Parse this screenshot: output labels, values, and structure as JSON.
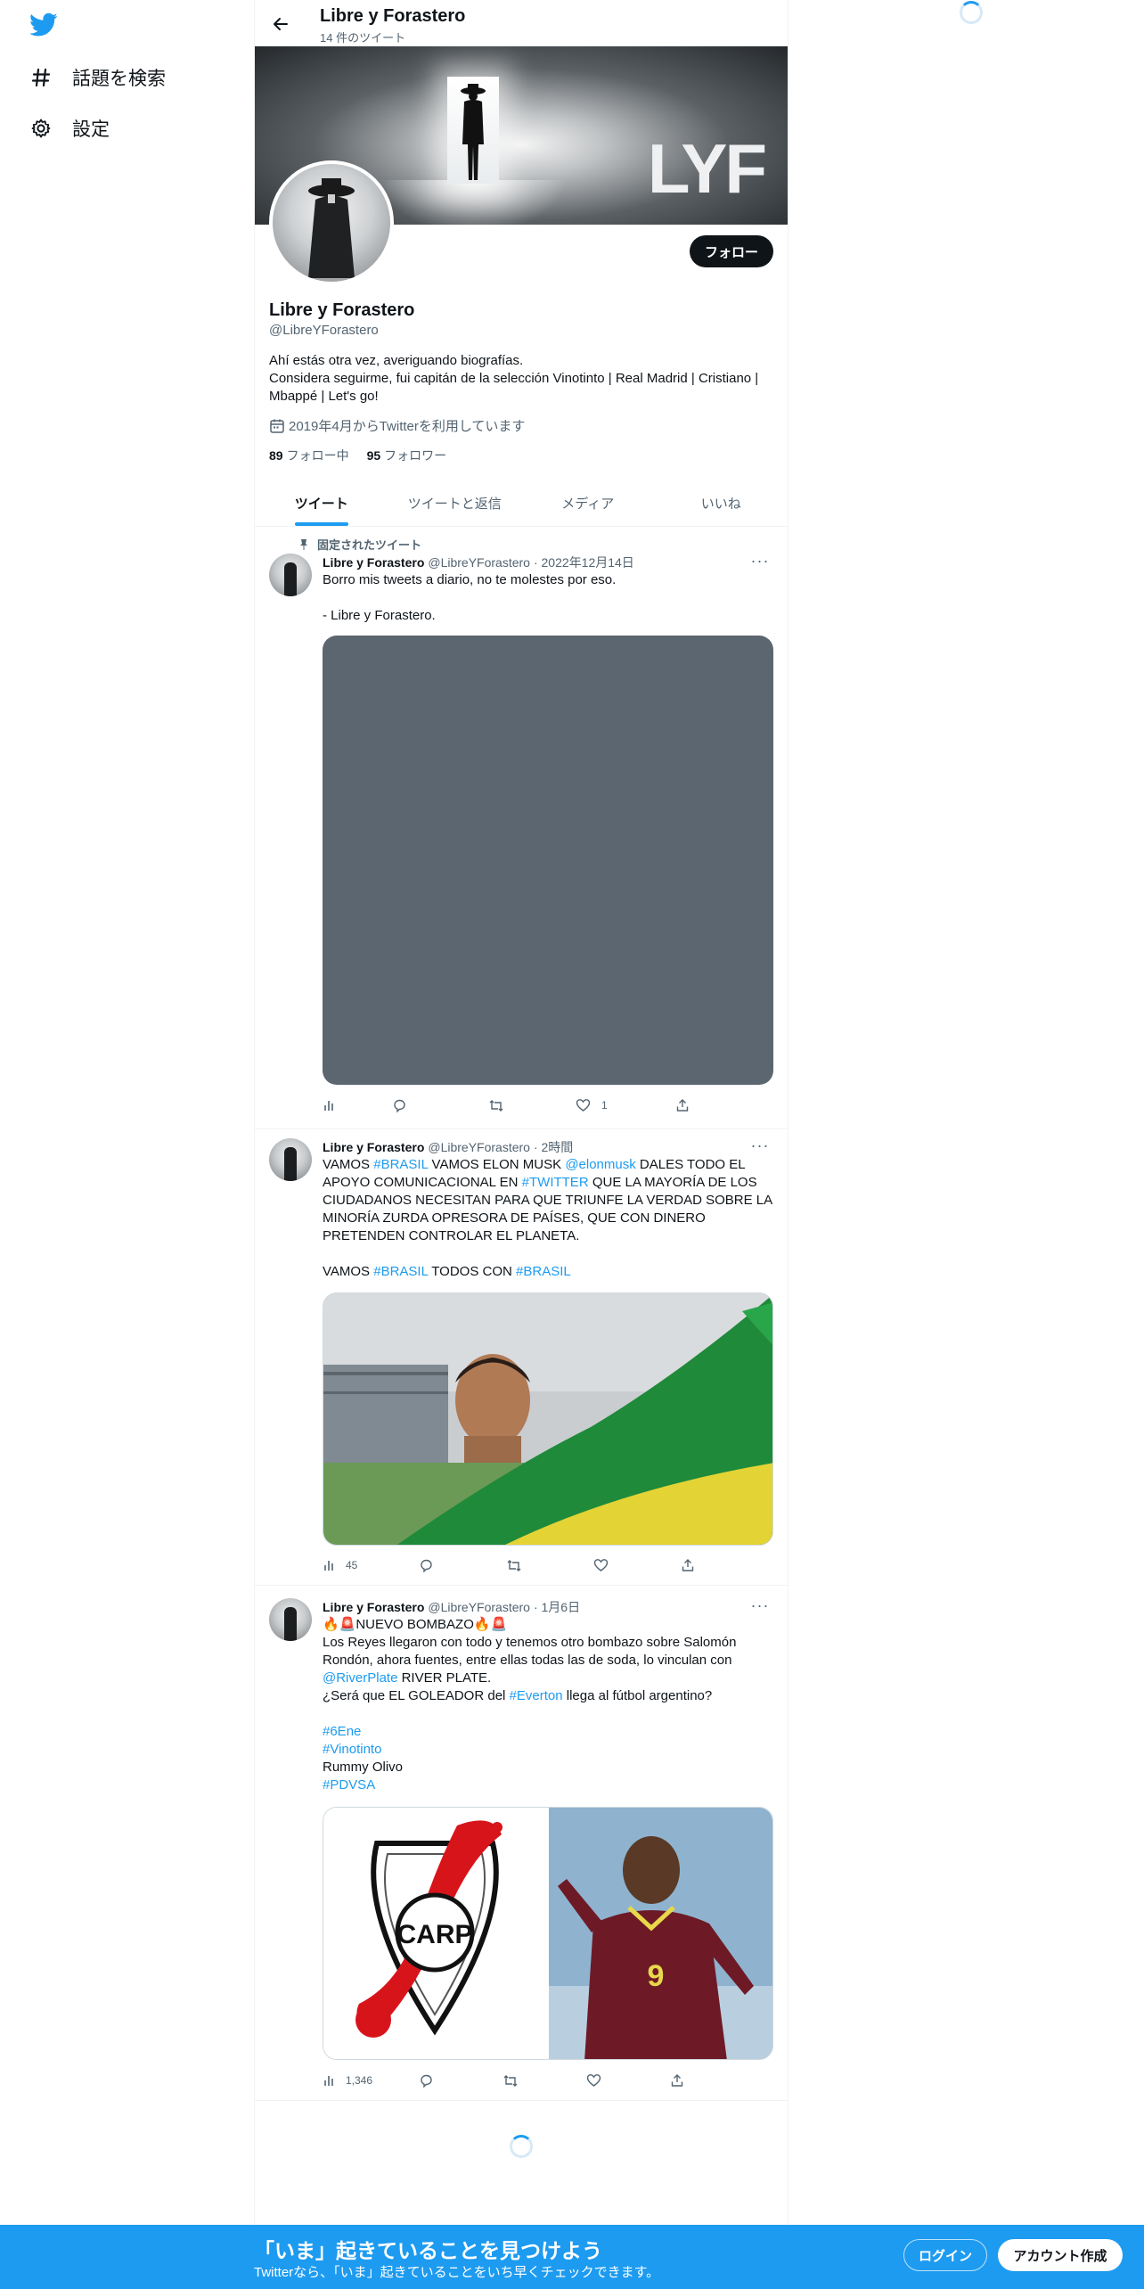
{
  "colors": {
    "accent": "#1d9bf0",
    "text": "#0f1419",
    "secondary": "#536471"
  },
  "sidebar": {
    "logo_icon": "twitter-bird-icon",
    "items": [
      {
        "label": "話題を検索",
        "icon": "hashtag-icon"
      },
      {
        "label": "設定",
        "icon": "gear-icon"
      }
    ]
  },
  "header": {
    "title": "Libre y Forastero",
    "subtitle": "14 件のツイート"
  },
  "profile": {
    "banner_text": "LYF",
    "follow_label": "フォロー",
    "name": "Libre y Forastero",
    "handle": "@LibreYForastero",
    "bio_line1": "Ahí estás otra vez, averiguando biografías.",
    "bio_line2": "Considera seguirme, fui capitán de la selección Vinotinto | Real Madrid | Cristiano | Mbappé | Let's go!",
    "joined": "2019年4月からTwitterを利用しています",
    "following_count": "89",
    "following_label": "フォロー中",
    "followers_count": "95",
    "followers_label": "フォロワー"
  },
  "tabs": [
    "ツイート",
    "ツイートと返信",
    "メディア",
    "いいね"
  ],
  "tweets": [
    {
      "pinned_label": "固定されたツイート",
      "name": "Libre y Forastero",
      "handle": "@LibreYForastero",
      "time": "· 2022年12月14日",
      "text": "Borro mis tweets a diario, no te molestes por eso.\n\n- Libre y Forastero.",
      "views": "",
      "likes": "1"
    },
    {
      "name": "Libre y Forastero",
      "handle": "@LibreYForastero",
      "time": "· 2時間",
      "t1": "VAMOS ",
      "l1": "#BRASIL",
      "t2": " VAMOS ELON MUSK ",
      "l2": "@elonmusk",
      "t3": " DALES TODO EL APOYO COMUNICACIONAL EN ",
      "l3": "#TWITTER",
      "t4": " QUE LA MAYORÍA DE LOS CIUDADANOS NECESITAN PARA QUE TRIUNFE LA VERDAD SOBRE LA MINORÍA ZURDA OPRESORA DE PAÍSES, QUE CON DINERO PRETENDEN CONTROLAR EL PLANETA.\n\nVAMOS ",
      "l4": "#BRASIL",
      "t5": " TODOS CON ",
      "l5": "#BRASIL",
      "views": "45",
      "likes": ""
    },
    {
      "name": "Libre y Forastero",
      "handle": "@LibreYForastero",
      "time": "· 1月6日",
      "t1": "🔥🚨NUEVO BOMBAZO🔥🚨\nLos Reyes llegaron con todo y tenemos otro bombazo sobre Salomón Rondón, ahora fuentes, entre ellas todas las de soda, lo vinculan con ",
      "l1": "@RiverPlate",
      "t2": " RIVER PLATE.\n¿Será que EL GOLEADOR del ",
      "l2": "#Everton",
      "t3": " llega al fútbol argentino?\n\n",
      "l3": "#6Ene",
      "l4": "#Vinotinto",
      "t4": "Rummy Olivo",
      "l5": "#PDVSA",
      "crest_text": "CARP",
      "jersey_number": "9",
      "views": "1,346",
      "likes": ""
    }
  ],
  "bottom": {
    "title": "「いま」起きていることを見つけよう",
    "subtitle": "Twitterなら、「いま」起きていることをいち早くチェックできます。",
    "login": "ログイン",
    "signup": "アカウント作成"
  }
}
